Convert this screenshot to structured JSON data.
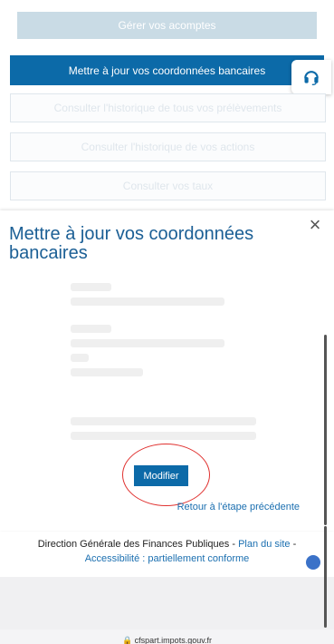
{
  "actions": {
    "manage_deposits": "Gérer vos acomptes",
    "update_bank": "Mettre à jour vos coordonnées bancaires",
    "history_withdrawals": "Consulter l'historique de tous vos prélèvements",
    "history_actions": "Consulter l'historique de vos actions",
    "rates": "Consulter vos taux"
  },
  "modal": {
    "title": "Mettre à jour vos coordonnées bancaires",
    "close_symbol": "×",
    "modify_label": "Modifier",
    "back_label": "Retour à l'étape précédente"
  },
  "footer": {
    "org": "Direction Générale des Finances Publiques",
    "separator": " - ",
    "sitemap": "Plan du site",
    "accessibility": "Accessibilité : partiellement conforme"
  },
  "browser": {
    "url": "cfspart.impots.gouv.fr"
  },
  "icons": {
    "help": "headset-icon",
    "close": "close-icon",
    "lock": "lock-icon"
  },
  "colors": {
    "primary": "#0c6aa8",
    "title": "#1b5f95",
    "link": "#1b6fb0",
    "highlight": "#e0312f"
  }
}
